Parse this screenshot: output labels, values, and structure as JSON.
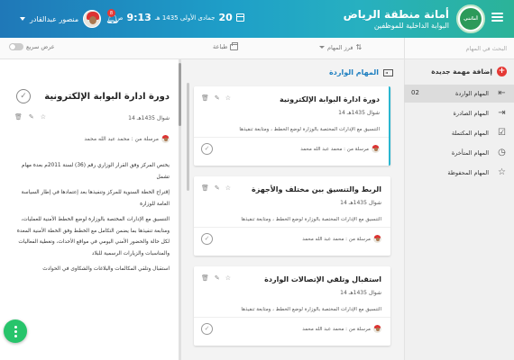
{
  "header": {
    "brand_title": "أمانة منطقة الرياض",
    "brand_subtitle": "البوابة الداخلية للموظفين",
    "logo_text": "أمانتي",
    "time": "9:13",
    "time_suffix": "ص",
    "date_day": "20",
    "date_text": "جمادى الأولى 1435 هـ",
    "notification_count": "8",
    "user_name": "منصور عبدالقادر"
  },
  "toolbar": {
    "search_placeholder": "البحث في المهام",
    "sort_label": "فرز المهام",
    "print_label": "طباعة",
    "quick_view_label": "عرض سريع"
  },
  "sidebar": {
    "new_task_label": "إضافة مهمة جديدة",
    "items": [
      {
        "label": "المهام الواردة",
        "count": "02",
        "icon": "inbox-icon",
        "glyph": "⇤"
      },
      {
        "label": "المهام الصادرة",
        "count": "",
        "icon": "outbox-icon",
        "glyph": "⇥"
      },
      {
        "label": "المهام المكتملة",
        "count": "",
        "icon": "checkbox-icon",
        "glyph": "☑"
      },
      {
        "label": "المهام المتأخرة",
        "count": "",
        "icon": "clock-icon",
        "glyph": "◷"
      },
      {
        "label": "المهام المحفوظة",
        "count": "",
        "icon": "star-icon",
        "glyph": "☆"
      }
    ]
  },
  "list": {
    "title": "المهام الواردة",
    "cards": [
      {
        "title": "دورة ادارة البوابة الإلكترونية",
        "date": "شوال 1435هـ 14",
        "desc": "التنسيق مع الإدارات المختصة بالوزارة لوضع الخطط ، ومتابعة تنفيذها",
        "sender": "مرسلة من : محمد عبد الله محمد"
      },
      {
        "title": "الربط والتنسيق بين مختلف   والأجهزة",
        "date": "شوال 1435هـ 14",
        "desc": "التنسيق مع الإدارات المختصة بالوزارة لوضع الخطط ، ومتابعة تنفيذها",
        "sender": "مرسلة من : محمد عبد الله محمد"
      },
      {
        "title": "استقبال وتلقي الإتصالات الواردة",
        "date": "شوال 1435هـ 14",
        "desc": "التنسيق مع الإدارات المختصة بالوزارة لوضع الخطط ، ومتابعة تنفيذها",
        "sender": "مرسلة من : محمد عبد الله محمد"
      }
    ]
  },
  "detail": {
    "title": "دورة ادارة البوابة الإلكترونية",
    "date": "شوال 1435هـ 14",
    "sender": "مرسلة من : محمد عبد الله محمد",
    "paragraphs": [
      "يختص المركز وفق القرار الوزاري رقم (36) لسنة 2011م بعدة مهام تشمل",
      "إقتراح الخطة السنوية للمركز وتنفيذها بعد إعتمادها في إطار السياسة العامة للوزارة",
      "التنسيق مع الإدارات المختصة بالوزارة لوضع الخطط الأمنية للعمليات، ومتابعة تنفيذها بما يضمن التكامل مع الخطط وفق الخطة الأمنية المعدة لكل حالة والحضور الأمني اليومي في مواقع الأحداث، وتغطية الفعاليات والمناسبات والزيارات الرسمية للبلاد",
      "استقبال وتلقي المكالمات والبلاغات والشكاوى في الحوادث"
    ]
  },
  "colors": {
    "header_start": "#1f78b8",
    "header_end": "#2bb398",
    "accent": "#1e7fc0",
    "alert": "#e53935",
    "fab": "#27c46b"
  }
}
